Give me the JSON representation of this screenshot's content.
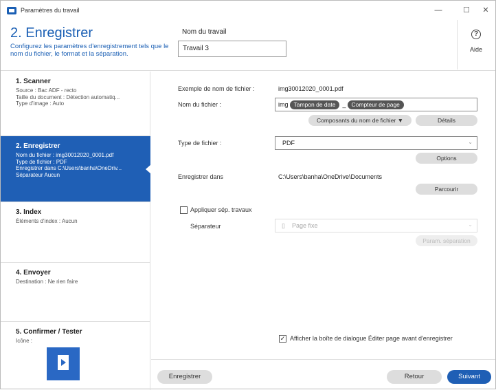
{
  "window": {
    "title": "Paramètres du travail",
    "minimize": "—",
    "maximize": "☐",
    "close": "✕"
  },
  "header": {
    "step_title": "2. Enregistrer",
    "step_description": "Configurez les paramètres d'enregistrement tels que le nom du fichier, le format et la séparation.",
    "job_name_label": "Nom du travail",
    "job_name_value": "Travail 3",
    "help_icon": "?",
    "help_label": "Aide"
  },
  "sidebar": {
    "items": [
      {
        "title": "1. Scanner",
        "lines": [
          "Source : Bac ADF - recto",
          "Taille du document : Détection automatiq...",
          "Type d'image : Auto"
        ]
      },
      {
        "title": "2. Enregistrer",
        "lines": [
          "Nom du fichier : img30012020_0001.pdf",
          "Type de fichier : PDF",
          "Enregistrer dans C:\\Users\\banha\\OneDriv...",
          "Séparateur Aucun"
        ]
      },
      {
        "title": "3. Index",
        "lines": [
          "Éléments d'index : Aucun"
        ]
      },
      {
        "title": "4. Envoyer",
        "lines": [
          "Destination : Ne rien faire"
        ]
      },
      {
        "title": "5. Confirmer / Tester",
        "lines": [
          "Icône :"
        ]
      }
    ]
  },
  "main": {
    "example_label": "Exemple de nom de fichier :",
    "example_value": "img30012020_0001.pdf",
    "filename_label": "Nom du fichier :",
    "filename_prefix": "img",
    "filename_chip_date": "Tampon de date",
    "filename_separator": "_",
    "filename_chip_counter": "Compteur de page",
    "components_button": "Composants du nom de fichier ▼",
    "details_button": "Détails",
    "filetype_label": "Type de fichier :",
    "filetype_value": "PDF",
    "options_button": "Options",
    "savein_label": "Enregistrer dans",
    "savein_value": "C:\\Users\\banha\\OneDrive\\Documents",
    "browse_button": "Parcourir",
    "apply_separation_label": "Appliquer sép. travaux",
    "apply_separation_checked": false,
    "separator_label": "Séparateur",
    "separator_value": "Page fixe",
    "separation_params_button": "Param. séparation",
    "show_edit_dialog_label": "Afficher la boîte de dialogue Éditer page avant d'enregistrer",
    "show_edit_dialog_checked": true
  },
  "footer": {
    "save_button": "Enregistrer",
    "back_button": "Retour",
    "next_button": "Suivant"
  },
  "colors": {
    "accent": "#1f5fb5",
    "chip": "#555555",
    "button_gray": "#dddddd"
  }
}
